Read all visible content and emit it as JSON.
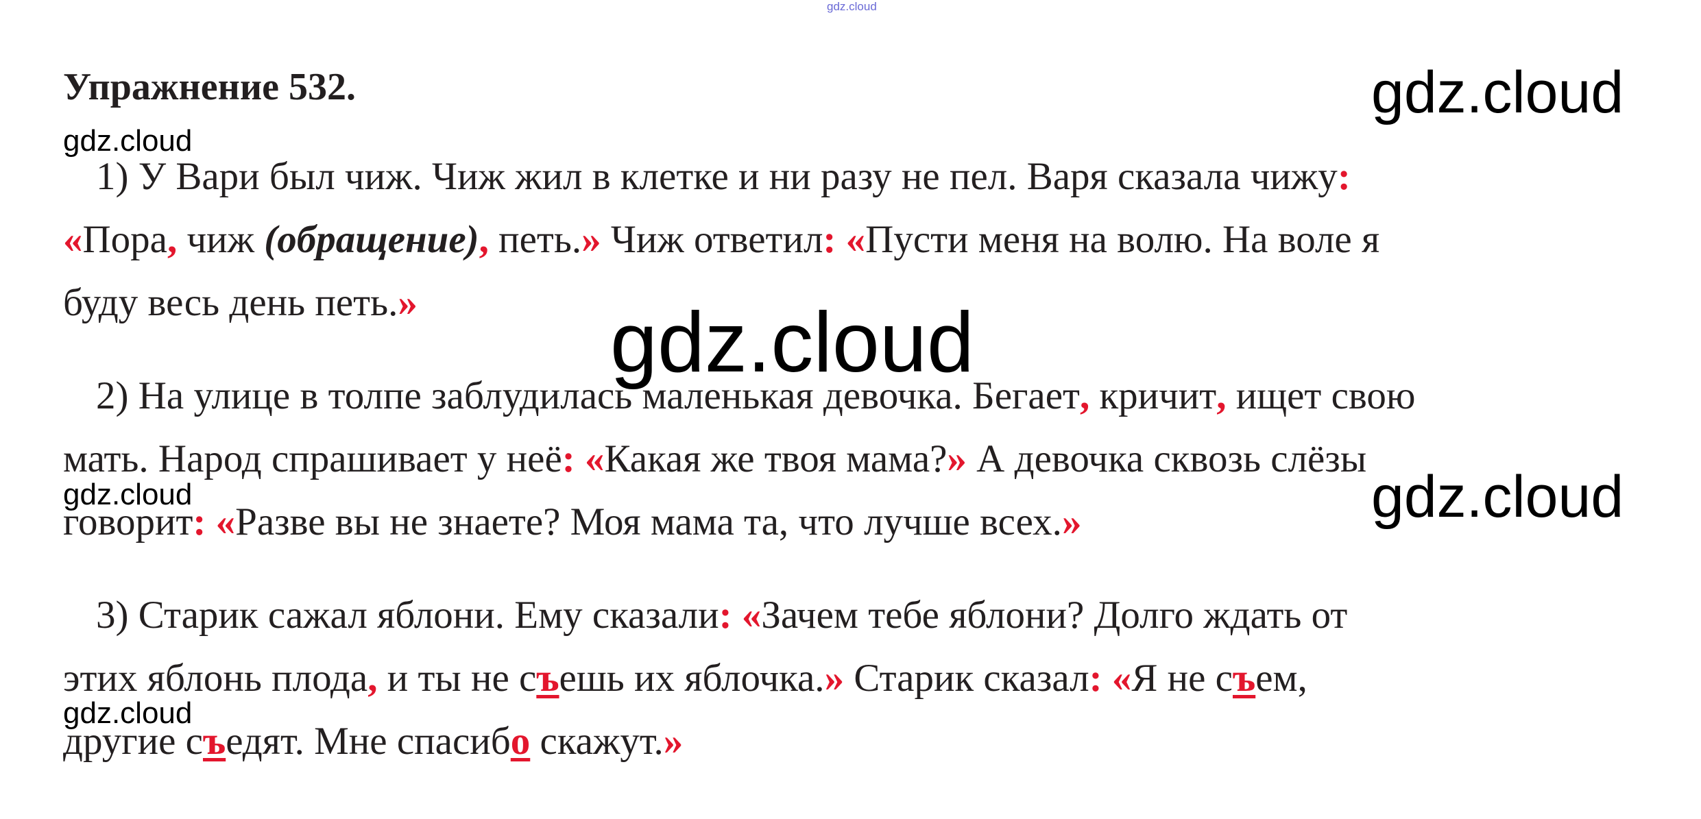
{
  "watermark": {
    "tiny": "gdz.cloud",
    "small": "gdz.cloud",
    "big": "gdz.cloud",
    "huge": "gdz.cloud"
  },
  "title": "Упражнение 532.",
  "p1": {
    "l1a": "1) У Вари был чиж. Чиж жил в клетке и ни разу не пел. Варя сказала чижу",
    "colon": ":",
    "oq": "«",
    "c": ",",
    "cq": "»",
    "l2a": "Пора",
    "l2b": " чиж ",
    "l2c": "(обращение)",
    "l2d": " петь.",
    "l2e": " Чиж ответил",
    "l2f": " ",
    "l2g": "Пусти меня на волю. На воле я",
    "l3a": "буду весь день петь."
  },
  "p2": {
    "l1a": "2) На улице в толпе заблудилась маленькая девочка. Бегает",
    "l1b": " кричит",
    "l1c": " ищет свою",
    "l2a": "мать. Народ спрашивает у неё",
    "l2b": "Какая же твоя мама?",
    "l2c": " А девочка сквозь слёзы",
    "l3a": "говорит",
    "l3b": "Разве вы не знаете? Моя мама та, что лучше всех."
  },
  "p3": {
    "l1a": "3) Старик сажал яблони. Ему сказали",
    "l1b": "Зачем тебе яблони? Долго ждать от",
    "l2a": "этих яблонь плода",
    "l2b": " и ты не с",
    "hard_sign": "ъ",
    "l2c": "ешь их яблочка.",
    "l2d": " Старик сказал",
    "l2e": "Я не с",
    "l2f": "ем,",
    "l3a": "другие с",
    "l3b": "едят. Мне спасиб",
    "o_letter": "о",
    "l3c": " скажут."
  }
}
